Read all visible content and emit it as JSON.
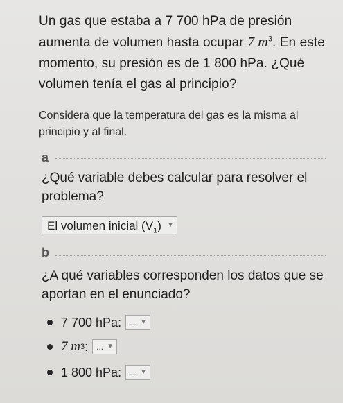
{
  "question": {
    "part1": "Un gas que estaba a 7 700 hPa de presión aumenta de volumen hasta ocupar ",
    "volume_value": "7 m",
    "volume_exp": "3",
    "part2": ". En este momento, su presión es de 1 800 hPa. ¿Qué volumen tenía el gas al principio?"
  },
  "hint": "Considera que la temperatura del gas es la misma al principio y al final.",
  "part_a": {
    "label": "a",
    "question": "¿Qué variable debes calcular para resolver el problema?",
    "select_text": "El volumen inicial (V",
    "select_sub": "1",
    "select_close": ")"
  },
  "part_b": {
    "label": "b",
    "question": "¿A qué variables corresponden los datos que se aportan en el enunciado?",
    "items": [
      {
        "text": "7 700 hPa:",
        "sup": "",
        "dropdown": "..."
      },
      {
        "text": "7 m",
        "sup": "3",
        "after": ":",
        "dropdown": "..."
      },
      {
        "text": "1 800 hPa:",
        "sup": "",
        "dropdown": "..."
      }
    ]
  },
  "icons": {
    "caret": "triangle-down"
  }
}
